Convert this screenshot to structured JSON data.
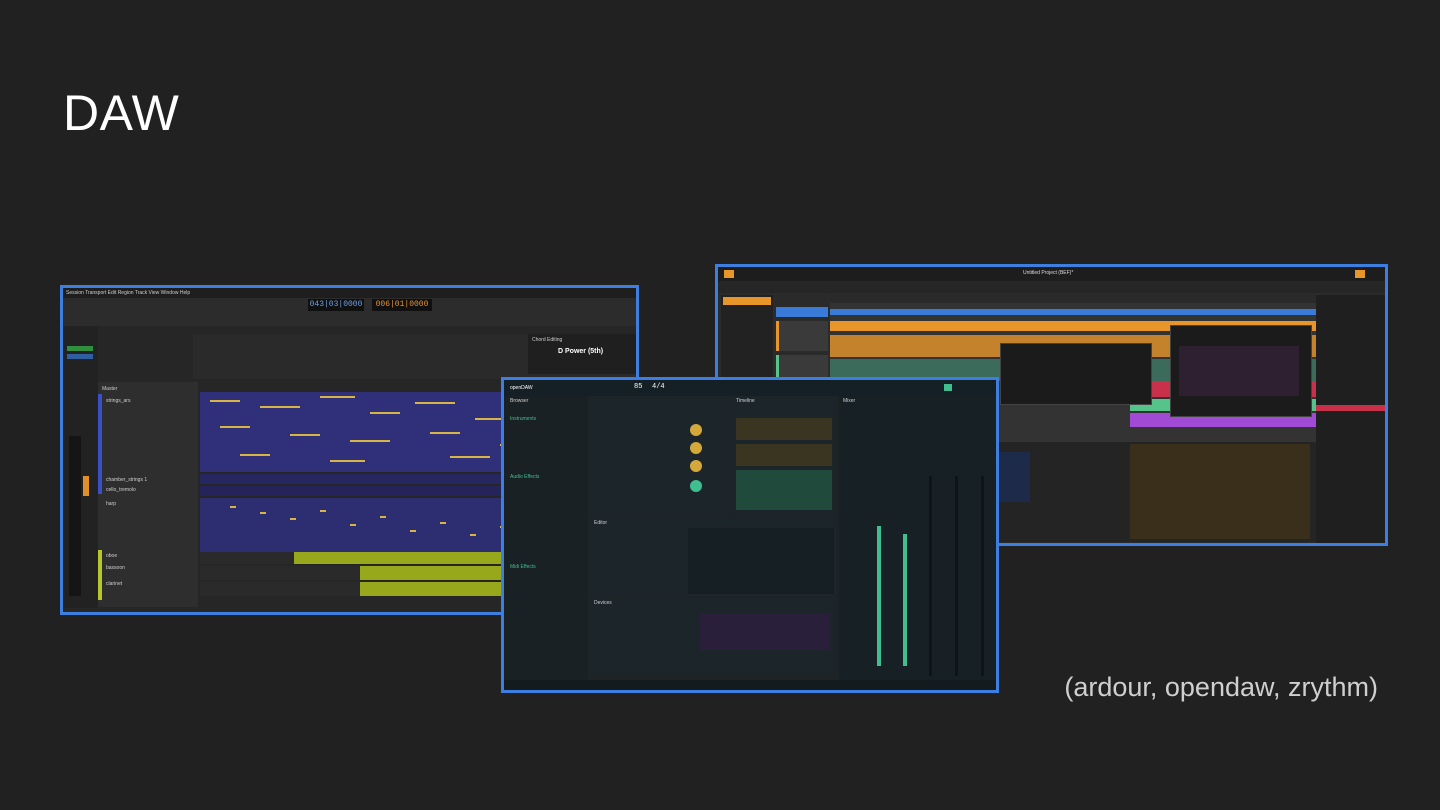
{
  "slide": {
    "title": "DAW",
    "caption": "(ardour, opendaw, zrythm)"
  },
  "ardour": {
    "menu": "Session  Transport  Edit  Region  Track  View  Window  Help",
    "clock_primary": "043|03|0000",
    "clock_secondary": "006|01|0000",
    "chord_panel_title": "Chord Editing",
    "chord_name": "D Power (5th)",
    "tracks": [
      {
        "name": "Master"
      },
      {
        "name": "strings_ars"
      },
      {
        "name": "chamber_strings 1"
      },
      {
        "name": "cello_tremolo"
      },
      {
        "name": "harp"
      },
      {
        "name": "oboe"
      },
      {
        "name": "bassoon"
      },
      {
        "name": "clarinet"
      }
    ],
    "colors": {
      "strings": "#30307a",
      "woodwinds": "#98a81c",
      "notes": "#d8b444"
    }
  },
  "opendaw": {
    "logo": "openDAW",
    "tempo": "85",
    "meter": "4/4",
    "sections": [
      "Browser",
      "Timeline",
      "Mixer",
      "Editor",
      "Devices"
    ],
    "browser_items": [
      "Instruments",
      "Audio Effects",
      "Midi Effects"
    ],
    "colors": {
      "accent": "#3fbf8f",
      "knob": "#d4a93a"
    }
  },
  "zrythm": {
    "window_title": "Untitled Project (BEF)*",
    "colors": {
      "track_orange": "#e8962a",
      "track_green": "#56c48a",
      "track_purple": "#a14ad6",
      "track_red": "#c9304a",
      "accent_blue": "#3a7ad8"
    }
  }
}
